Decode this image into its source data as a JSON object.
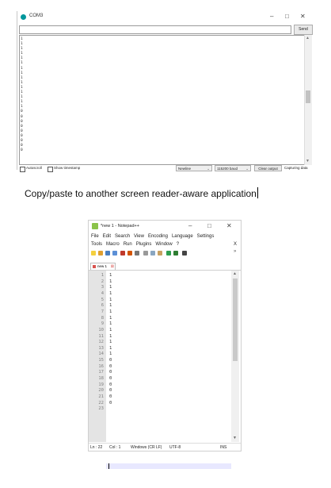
{
  "serial": {
    "title": "COM3",
    "send_label": "Send",
    "input_value": "",
    "lines": [
      "1",
      "1",
      "1",
      "1",
      "1",
      "1",
      "1",
      "1",
      "1",
      "1",
      "1",
      "1",
      "1",
      "1",
      "1",
      "0",
      "0",
      "0",
      "0",
      "0",
      "0",
      "0",
      "0",
      "0"
    ],
    "autoscroll_label": "Autoscroll",
    "timestamp_label": "Show timestamp",
    "line_ending": "Newline",
    "baud": "115200 baud",
    "clear_label": "Clear output",
    "capturing_label": "Capturing data"
  },
  "window_controls": {
    "minimize": "–",
    "maximize": "□",
    "close": "✕"
  },
  "caption": {
    "text": "Copy/paste to another screen reader-aware application"
  },
  "npp": {
    "title": "*new 1 - Notepad++",
    "menu_row1": [
      "File",
      "Edit",
      "Search",
      "View",
      "Encoding",
      "Language",
      "Settings"
    ],
    "menu_row2": [
      "Tools",
      "Macro",
      "Run",
      "Plugins",
      "Window",
      "?"
    ],
    "menu_close": "X",
    "toolbar_more": "»",
    "tab_label": "new 1",
    "line_numbers": [
      "1",
      "2",
      "3",
      "4",
      "5",
      "6",
      "7",
      "8",
      "9",
      "10",
      "11",
      "12",
      "13",
      "14",
      "15",
      "16",
      "17",
      "18",
      "19",
      "20",
      "21",
      "22",
      "23"
    ],
    "lines": [
      "1",
      "1",
      "1",
      "1",
      "1",
      "1",
      "1",
      "1",
      "1",
      "1",
      "1",
      "1",
      "1",
      "1",
      "0",
      "0",
      "0",
      "0",
      "0",
      "0",
      "0",
      "0",
      ""
    ],
    "status": {
      "ln": "Ln : 22",
      "col": "Col : 1",
      "eol": "Windows (CR LF)",
      "encoding": "UTF-8",
      "mode": "INS"
    }
  }
}
